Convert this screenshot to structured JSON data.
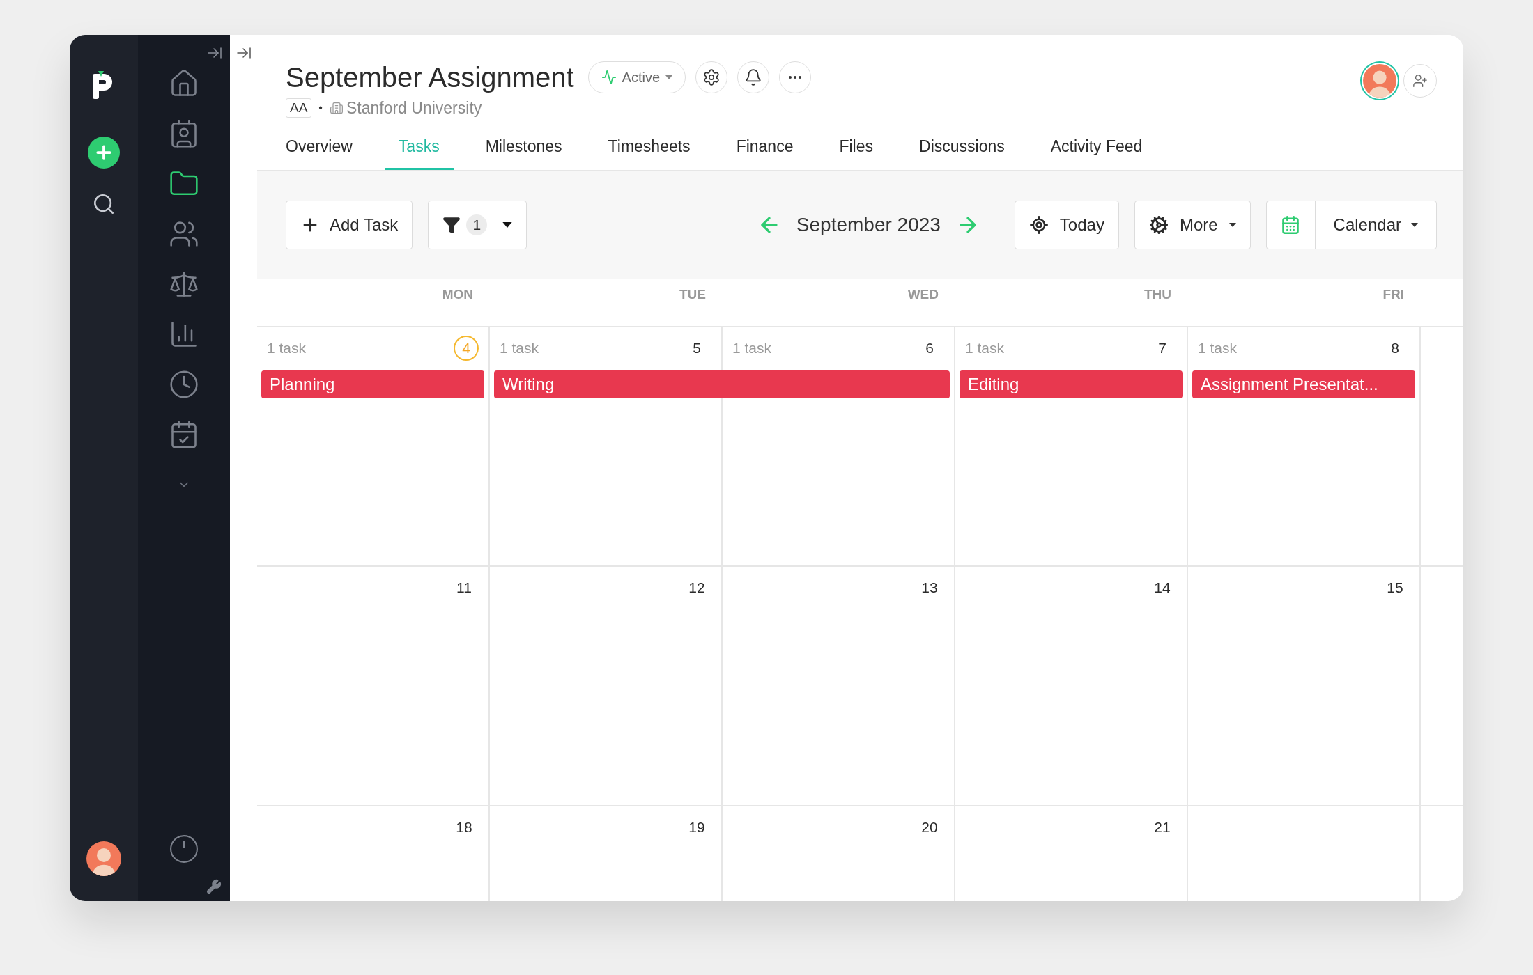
{
  "sidebar": {
    "nav_items": [
      {
        "selected": false
      },
      {
        "selected": false
      },
      {
        "selected": true
      },
      {
        "selected": false
      },
      {
        "selected": false
      },
      {
        "selected": false
      },
      {
        "selected": false
      },
      {
        "selected": false
      }
    ]
  },
  "project": {
    "title": "September Assignment",
    "status": "Active",
    "initials": "AA",
    "separator": "•",
    "client": "Stanford University"
  },
  "tabs": [
    {
      "label": "Overview",
      "selected": false
    },
    {
      "label": "Tasks",
      "selected": true
    },
    {
      "label": "Milestones",
      "selected": false
    },
    {
      "label": "Timesheets",
      "selected": false
    },
    {
      "label": "Finance",
      "selected": false
    },
    {
      "label": "Files",
      "selected": false
    },
    {
      "label": "Discussions",
      "selected": false
    },
    {
      "label": "Activity Feed",
      "selected": false
    }
  ],
  "toolbar": {
    "add_task": "Add Task",
    "filter_count": "1",
    "month": "September 2023",
    "today": "Today",
    "more": "More",
    "view": "Calendar"
  },
  "weekdays": [
    "MON",
    "TUE",
    "WED",
    "THU",
    "FRI"
  ],
  "weeks": [
    {
      "groups": [
        {
          "days": [
            {
              "number": "4",
              "task_count": "1 task",
              "today": true
            }
          ],
          "event": "Planning"
        },
        {
          "days": [
            {
              "number": "5",
              "task_count": "1 task",
              "today": false
            },
            {
              "number": "6",
              "task_count": "1 task",
              "today": false
            }
          ],
          "event": "Writing"
        },
        {
          "days": [
            {
              "number": "7",
              "task_count": "1 task",
              "today": false
            }
          ],
          "event": "Editing"
        },
        {
          "days": [
            {
              "number": "8",
              "task_count": "1 task",
              "today": false
            }
          ],
          "event": "Assignment Presentat..."
        }
      ]
    },
    {
      "groups": [
        {
          "days": [
            {
              "number": "11",
              "today": false
            }
          ]
        },
        {
          "days": [
            {
              "number": "12",
              "today": false
            }
          ]
        },
        {
          "days": [
            {
              "number": "13",
              "today": false
            }
          ]
        },
        {
          "days": [
            {
              "number": "14",
              "today": false
            }
          ]
        },
        {
          "days": [
            {
              "number": "15",
              "today": false
            }
          ]
        }
      ]
    },
    {
      "groups": [
        {
          "days": [
            {
              "number": "18",
              "today": false
            }
          ]
        },
        {
          "days": [
            {
              "number": "19",
              "today": false
            }
          ]
        },
        {
          "days": [
            {
              "number": "20",
              "today": false
            }
          ]
        },
        {
          "days": [
            {
              "number": "21",
              "today": false
            }
          ]
        }
      ]
    }
  ]
}
